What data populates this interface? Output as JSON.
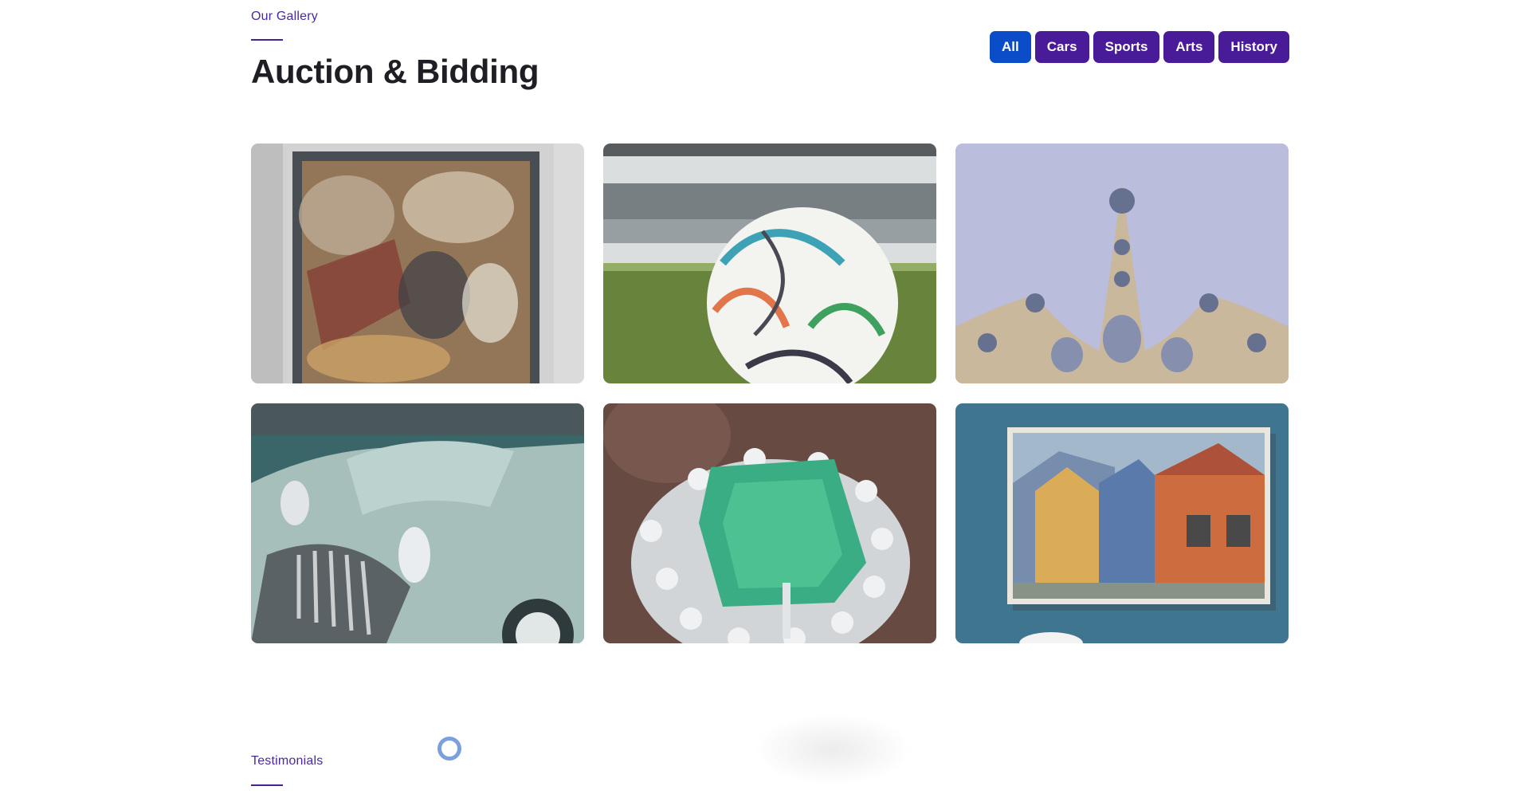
{
  "gallery": {
    "eyebrow": "Our Gallery",
    "title": "Auction & Bidding"
  },
  "filters": [
    {
      "label": "All",
      "active": true
    },
    {
      "label": "Cars",
      "active": false
    },
    {
      "label": "Sports",
      "active": false
    },
    {
      "label": "Arts",
      "active": false
    },
    {
      "label": "History",
      "active": false
    }
  ],
  "gallery_items": [
    {
      "subject": "framed-baroque-painting"
    },
    {
      "subject": "soccer-ball-stadium"
    },
    {
      "subject": "jeweled-tiara"
    },
    {
      "subject": "vintage-car-grille"
    },
    {
      "subject": "emerald-diamond-ring"
    },
    {
      "subject": "framed-street-painting"
    }
  ],
  "testimonials": {
    "eyebrow": "Testimonials"
  },
  "colors": {
    "accent": "#4a1b98",
    "active_filter": "#0b4dc8",
    "loader": "#7aa0dd"
  }
}
